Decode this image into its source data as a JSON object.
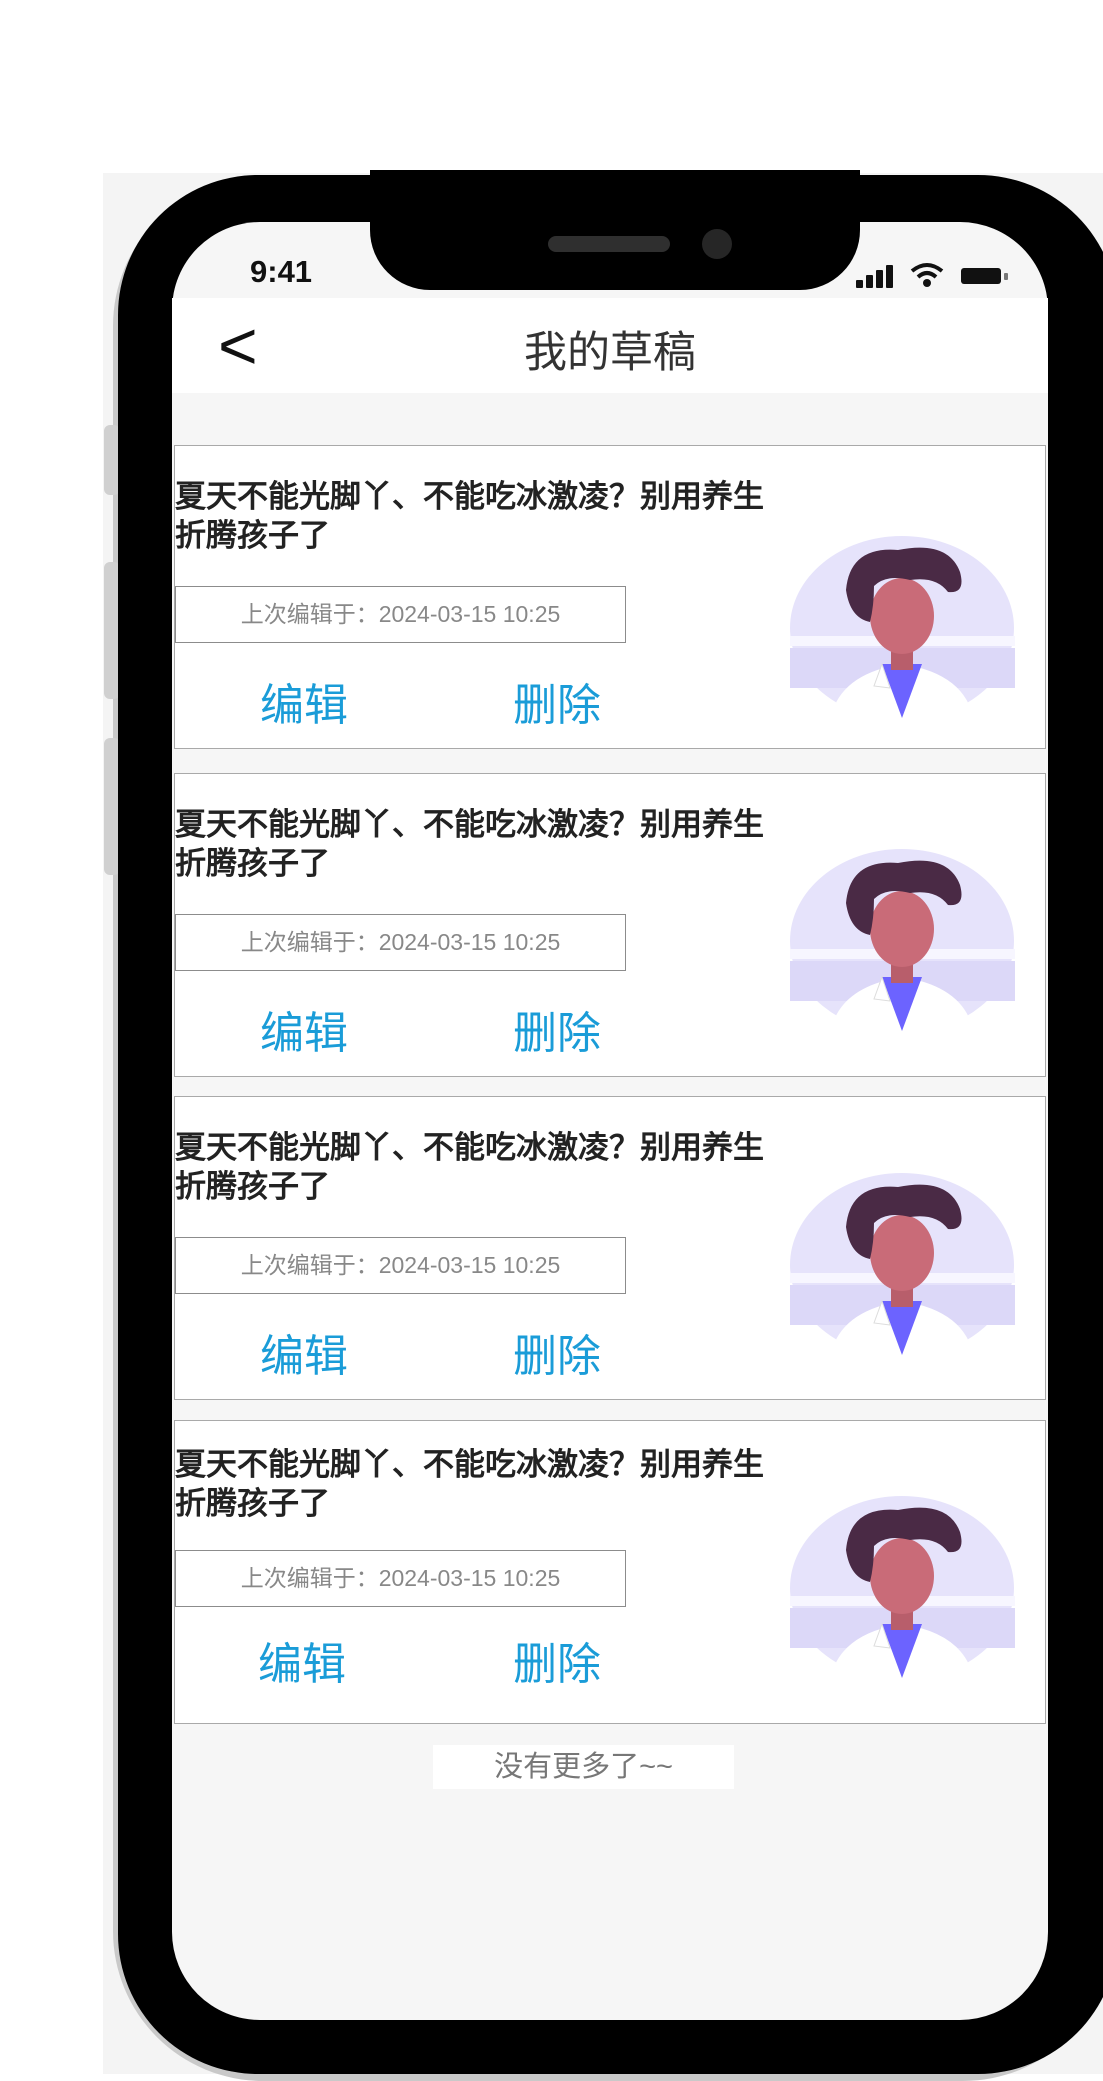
{
  "status_bar": {
    "time": "9:41"
  },
  "header": {
    "back_label": "<",
    "title": "我的草稿"
  },
  "cards": [
    {
      "title": "夏天不能光脚丫、不能吃冰激凌？别用养生折腾孩子了",
      "date": "上次编辑于：2024-03-15 10:25",
      "edit_label": "编辑",
      "delete_label": "删除"
    },
    {
      "title": "夏天不能光脚丫、不能吃冰激凌？别用养生折腾孩子了",
      "date": "上次编辑于：2024-03-15 10:25",
      "edit_label": "编辑",
      "delete_label": "删除"
    },
    {
      "title": "夏天不能光脚丫、不能吃冰激凌？别用养生折腾孩子了",
      "date": "上次编辑于：2024-03-15 10:25",
      "edit_label": "编辑",
      "delete_label": "删除"
    },
    {
      "title": "夏天不能光脚丫、不能吃冰激凌？别用养生折腾孩子了",
      "date": "上次编辑于：2024-03-15 10:25",
      "edit_label": "编辑",
      "delete_label": "删除"
    }
  ],
  "footer": {
    "no_more": "没有更多了~~"
  },
  "icons": {
    "avatar": "doctor-avatar-icon",
    "back": "back-arrow-icon",
    "signal": "signal-icon",
    "wifi": "wifi-icon",
    "battery": "battery-icon"
  },
  "colors": {
    "accent": "#1a9cd8",
    "avatar_bg": "#e6e3fb",
    "hair": "#4a2a45",
    "skin": "#c96b78",
    "shirt": "#6c63ff"
  }
}
